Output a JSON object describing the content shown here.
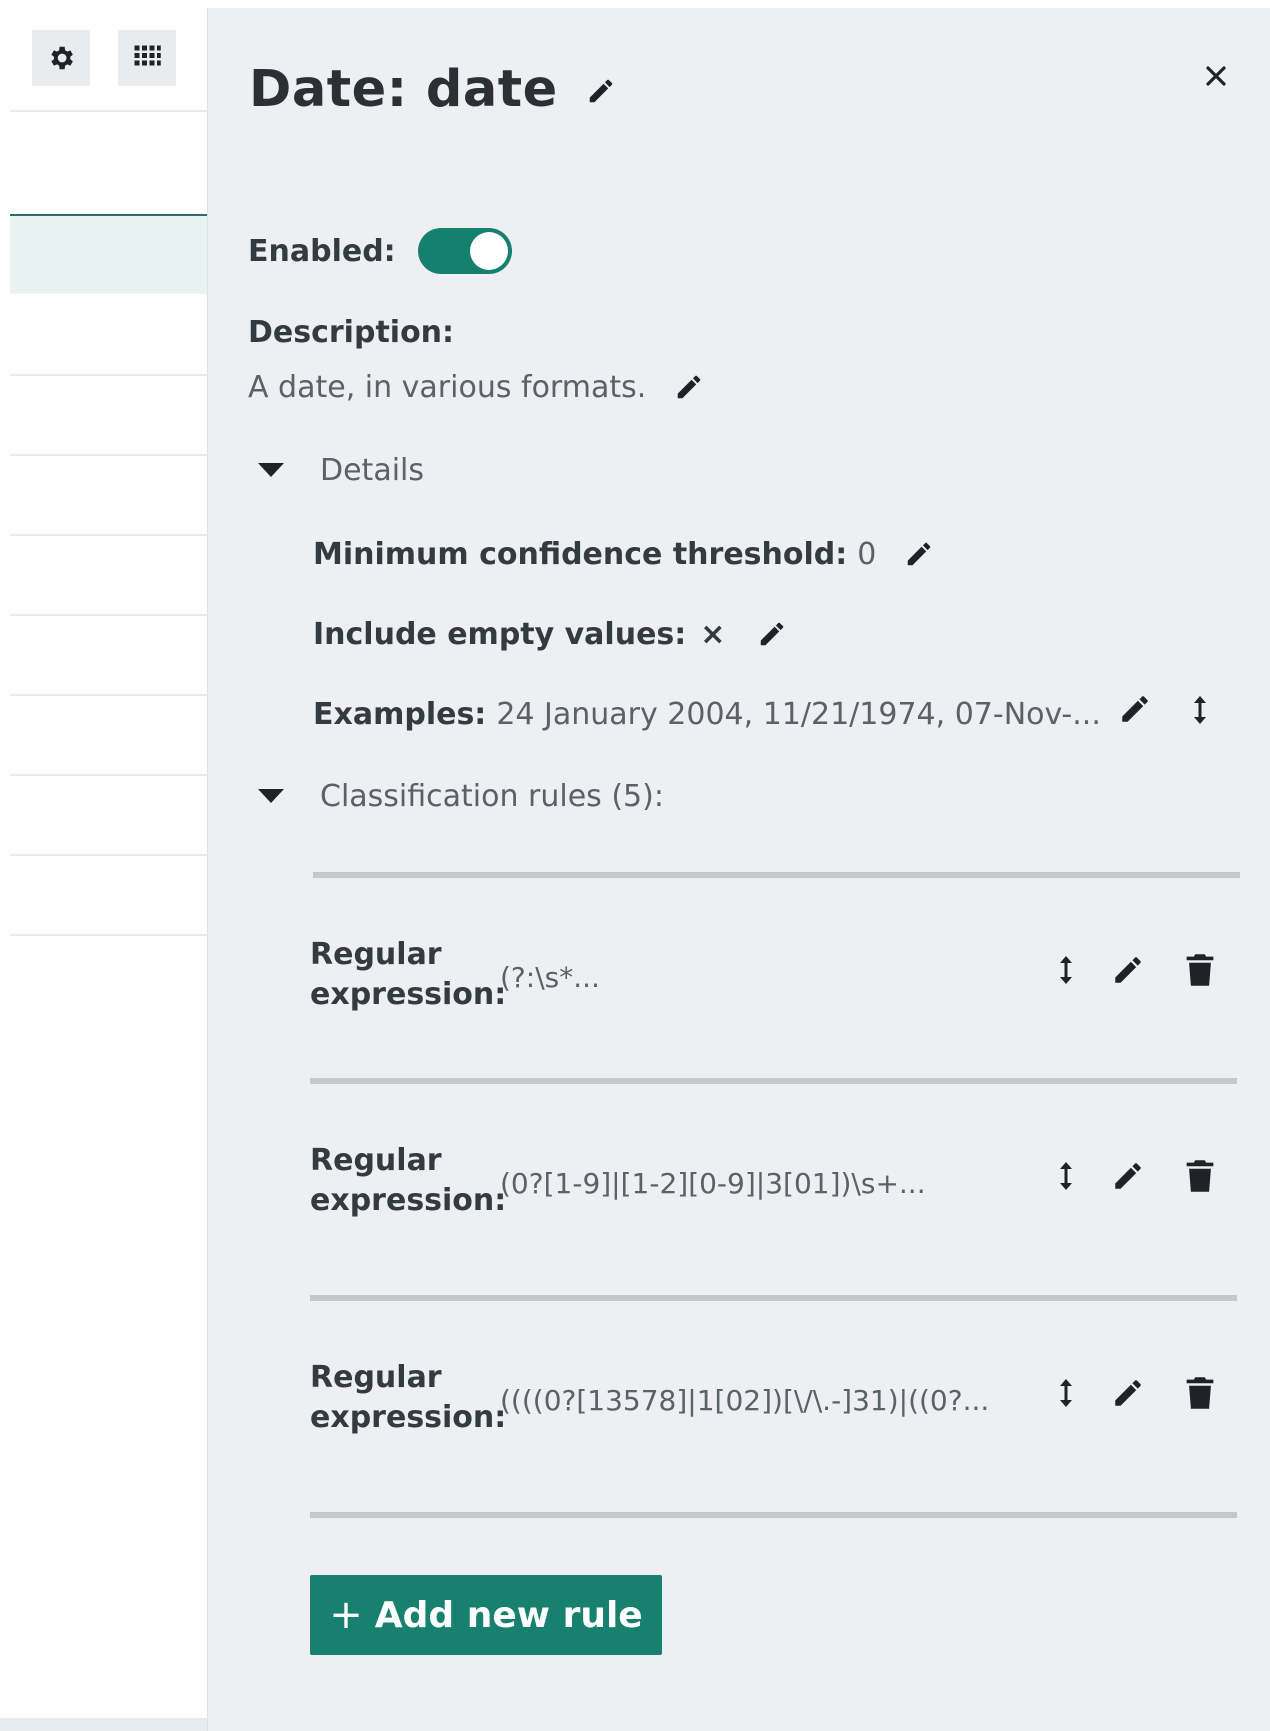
{
  "toolbar": {
    "settings_icon": "gear-icon",
    "apps_icon": "grid-icon"
  },
  "drawer": {
    "title": "Date: date",
    "enabled_label": "Enabled:",
    "enabled": true,
    "description_label": "Description:",
    "description": "A date, in various formats.",
    "details_label": "Details",
    "details": {
      "min_confidence_label": "Minimum confidence threshold:",
      "min_confidence_value": "0",
      "include_empty_label": "Include empty values:",
      "include_empty_value": "×",
      "examples_label": "Examples:",
      "examples_value": "24 January 2004, 11/21/1974, 07-Nov-..."
    },
    "rules_label": "Classification rules (5):",
    "rules": [
      {
        "label": "Regular expression:",
        "value": "(?:\\s*..."
      },
      {
        "label": "Regular expression:",
        "value": "(0?[1-9]|[1-2][0-9]|3[01])\\s+..."
      },
      {
        "label": "Regular expression:",
        "value": "((((0?[13578]|1[02])[\\/\\.-]31)|((0?..."
      }
    ],
    "add_rule_plus": "+",
    "add_rule_label": "Add new rule"
  },
  "colors": {
    "accent": "#17806f",
    "drawer_bg": "#edeff2",
    "text_dark": "#2b3035",
    "text_muted": "#5a6167"
  }
}
